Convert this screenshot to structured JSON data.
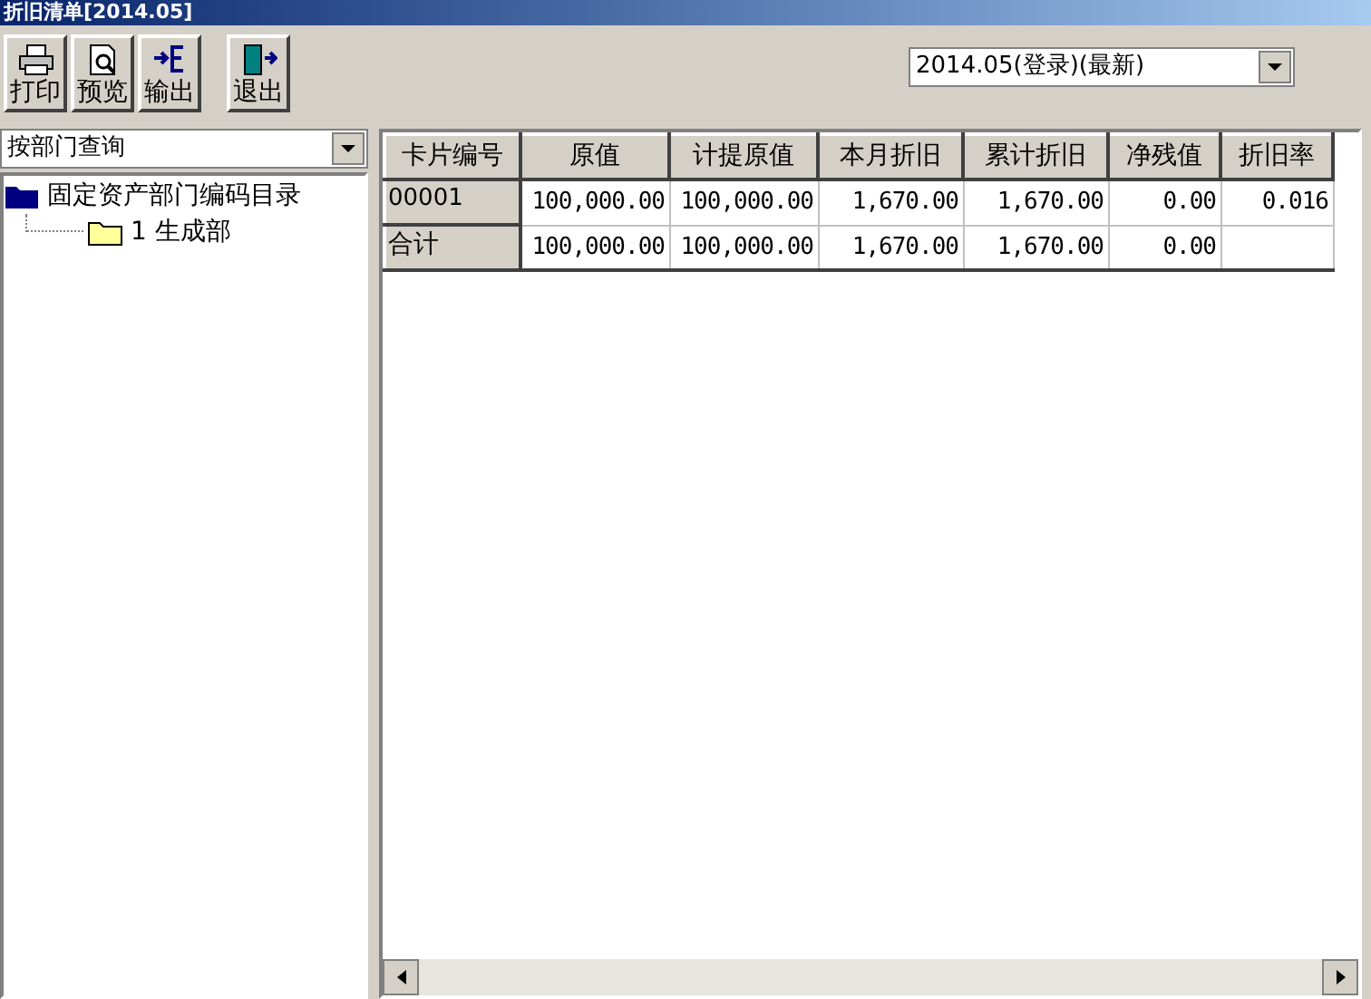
{
  "window": {
    "title": "折旧清单[2014.05]"
  },
  "toolbar": [
    {
      "label": "打印",
      "kind": "print"
    },
    {
      "label": "预览",
      "kind": "preview"
    },
    {
      "label": "输出",
      "kind": "export"
    },
    {
      "label": "退出",
      "kind": "exit"
    }
  ],
  "period_select": {
    "value": "2014.05(登录)(最新)"
  },
  "query_select": {
    "value": "按部门查询"
  },
  "tree": [
    {
      "label": "固定资产部门编码目录",
      "expanded": true,
      "children": [
        {
          "label": "1 生成部"
        }
      ]
    }
  ],
  "table": {
    "columns": [
      "卡片编号",
      "原值",
      "计提原值",
      "本月折旧",
      "累计折旧",
      "净残值",
      "折旧率"
    ],
    "rows": [
      {
        "cells": [
          "00001",
          "100,000.00",
          "100,000.00",
          "1,670.00",
          "1,670.00",
          "0.00",
          "0.016"
        ],
        "kind": "data"
      },
      {
        "cells": [
          "合计",
          "100,000.00",
          "100,000.00",
          "1,670.00",
          "1,670.00",
          "0.00",
          ""
        ],
        "kind": "total"
      }
    ]
  }
}
